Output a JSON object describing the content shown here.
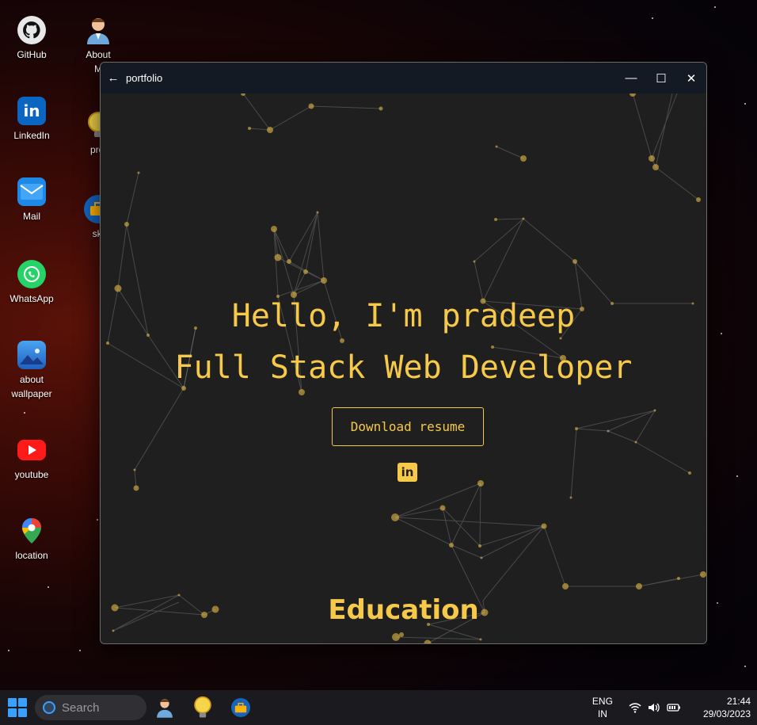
{
  "desktop": {
    "icons": [
      {
        "label": "GitHub",
        "icon": "github-icon"
      },
      {
        "label": "About\nM",
        "icon": "person-icon"
      },
      {
        "label": "LinkedIn",
        "icon": "linkedin-icon"
      },
      {
        "label": "proj",
        "icon": "bulb-icon"
      },
      {
        "label": "Mail",
        "icon": "mail-icon"
      },
      {
        "label": "ski",
        "icon": "toolbox-icon"
      },
      {
        "label": "WhatsApp",
        "icon": "whatsapp-icon"
      },
      {
        "label": "about\nwallpaper",
        "icon": "picture-icon"
      },
      {
        "label": "youtube",
        "icon": "youtube-icon"
      },
      {
        "label": "location",
        "icon": "map-pin-icon"
      }
    ]
  },
  "window": {
    "title": "portfolio",
    "back_glyph": "←",
    "minimize_glyph": "—",
    "maximize_glyph": "☐",
    "close_glyph": "✕"
  },
  "page": {
    "hello": "Hello, I'm pradeep",
    "role": "Full Stack Web Developer",
    "resume_button": "Download resume",
    "linkedin_glyph": "in",
    "education_heading": "Education",
    "accent": "#f7c948",
    "background": "#1f1f1f"
  },
  "taskbar": {
    "search_placeholder": "Search",
    "lang_line1": "ENG",
    "lang_line2": "IN",
    "time": "21:44",
    "date": "29/03/2023",
    "pinned": [
      "person-icon",
      "bulb-icon",
      "toolbox-icon"
    ]
  }
}
